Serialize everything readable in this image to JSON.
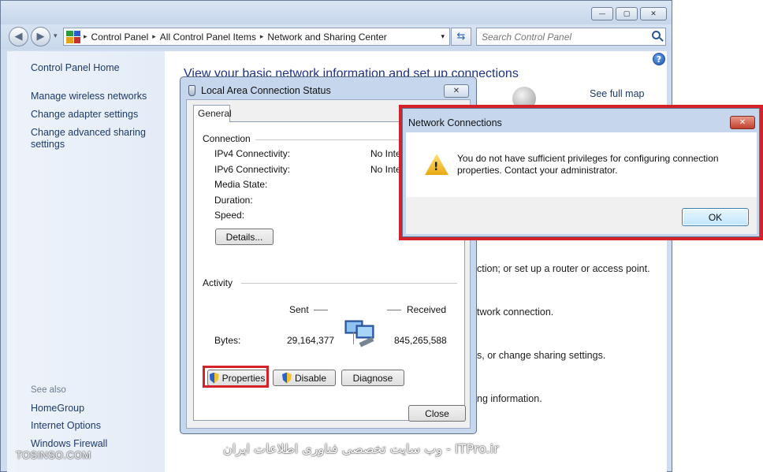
{
  "window": {
    "minimize_glyph": "—",
    "maximize_glyph": "▢",
    "close_glyph": "✕"
  },
  "navbar": {
    "back_glyph": "◀",
    "forward_glyph": "▶",
    "history_glyph": "▾",
    "breadcrumbs": [
      "Control Panel",
      "All Control Panel Items",
      "Network and Sharing Center"
    ],
    "breadcrumb_sep": "▸",
    "address_chevron": "▾",
    "refresh_glyph": "⇆",
    "search_placeholder": "Search Control Panel"
  },
  "left_pane": {
    "home": "Control Panel Home",
    "tasks": [
      "Manage wireless networks",
      "Change adapter settings",
      "Change advanced sharing settings"
    ],
    "see_also_title": "See also",
    "see_also": [
      "HomeGroup",
      "Internet Options",
      "Windows Firewall"
    ]
  },
  "right_pane": {
    "title": "View your basic network information and set up connections",
    "help_glyph": "?",
    "see_full_map": "See full map",
    "snippets": [
      "ction; or set up a router or access point.",
      "twork connection.",
      "s, or change sharing settings.",
      "ng information."
    ]
  },
  "status_dialog": {
    "title": "Local Area Connection Status",
    "close_glyph": "✕",
    "tab": "General",
    "connection_group": "Connection",
    "rows": [
      {
        "label": "IPv4 Connectivity:",
        "value": "No Inte"
      },
      {
        "label": "IPv6 Connectivity:",
        "value": "No Inte"
      },
      {
        "label": "Media State:",
        "value": ""
      },
      {
        "label": "Duration:",
        "value": ""
      },
      {
        "label": "Speed:",
        "value": ""
      }
    ],
    "details_button": "Details...",
    "activity_group": "Activity",
    "sent_label": "Sent",
    "received_label": "Received",
    "bytes_label": "Bytes:",
    "bytes_sent": "29,164,377",
    "bytes_received": "845,265,588",
    "properties_button": "Properties",
    "disable_button": "Disable",
    "diagnose_button": "Diagnose",
    "close_button": "Close"
  },
  "error_dialog": {
    "title": "Network Connections",
    "close_glyph": "✕",
    "message": "You do not have sufficient privileges for configuring connection properties. Contact your administrator.",
    "warn_glyph": "!",
    "ok_button": "OK"
  },
  "watermarks": {
    "left": "TOSINSO.COM",
    "center": "ITPro.ir - وب سایت تخصصی فناوری اطلاعات ایران"
  },
  "colors": {
    "highlight_red": "#d3222a",
    "link_blue": "#1d3a6b",
    "title_blue": "#1e3287"
  }
}
